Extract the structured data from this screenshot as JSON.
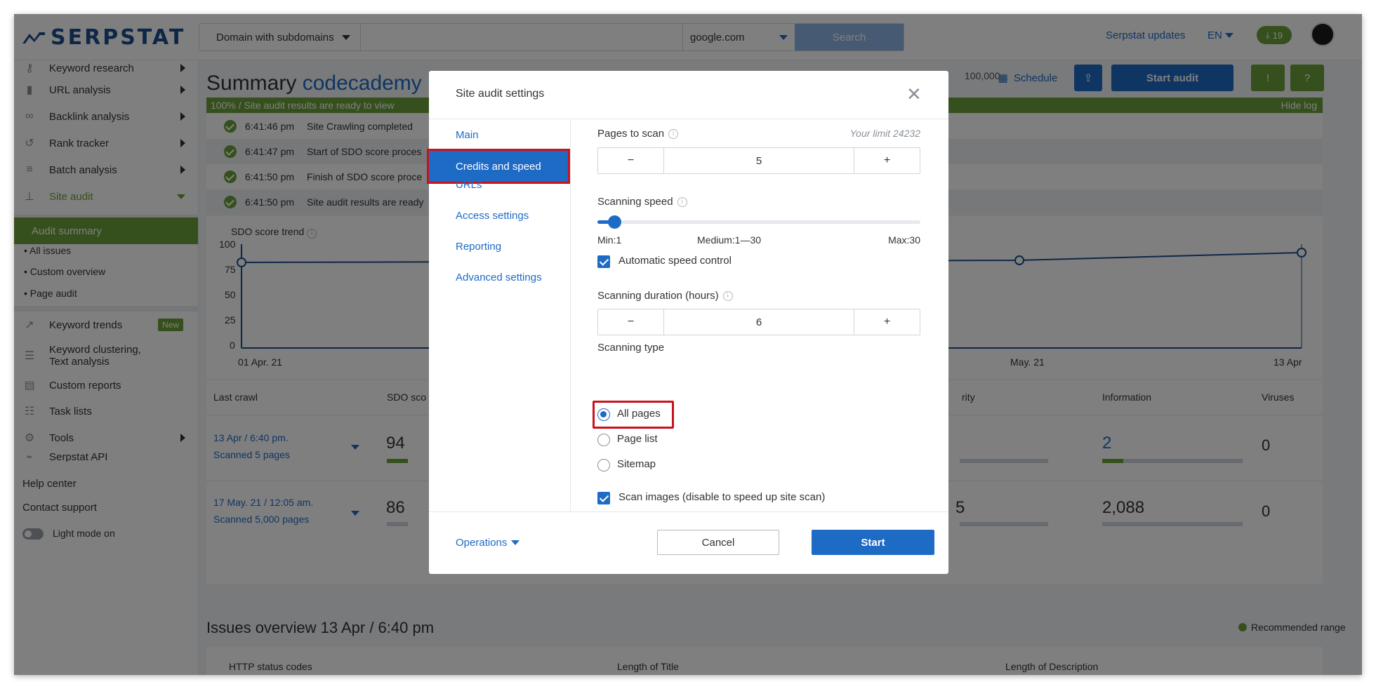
{
  "app": {
    "logo_text": "SERPSTAT",
    "brand_color": "#1d4f8f",
    "accent_color": "#6aa039",
    "link_color": "#1e6bc6"
  },
  "topbar": {
    "search_mode": "Domain with subdomains",
    "search_db": "google.com",
    "search_button": "Search",
    "updates_link": "Serpstat updates",
    "lang": "EN",
    "downloads_count": "19"
  },
  "sidebar": {
    "items": [
      {
        "label": "Keyword research",
        "icon": "key-icon"
      },
      {
        "label": "URL analysis",
        "icon": "bar-chart-icon"
      },
      {
        "label": "Backlink analysis",
        "icon": "link-icon"
      },
      {
        "label": "Rank tracker",
        "icon": "history-icon"
      },
      {
        "label": "Batch analysis",
        "icon": "database-icon"
      },
      {
        "label": "Site audit",
        "icon": "sitemap-icon"
      }
    ],
    "site_audit_sub": {
      "active": "Audit summary",
      "items": [
        "All issues",
        "Custom overview",
        "Page audit"
      ]
    },
    "tools": [
      {
        "label": "Keyword trends",
        "badge": "New",
        "icon": "trend-icon"
      },
      {
        "label": "Keyword clustering, Text analysis",
        "icon": "list-icon"
      },
      {
        "label": "Custom reports",
        "icon": "report-icon"
      },
      {
        "label": "Task lists",
        "icon": "checklist-icon"
      },
      {
        "label": "Tools",
        "icon": "gear-icon"
      },
      {
        "label": "Serpstat API",
        "icon": "api-icon"
      }
    ],
    "footer": {
      "help": "Help center",
      "support": "Contact support",
      "light_mode": "Light mode on"
    }
  },
  "main": {
    "title_prefix": "Summary",
    "title_domain": "codecademy",
    "credits_text": "100,000",
    "schedule_label": "Schedule",
    "start_audit_label": "Start audit",
    "progress_text": "100% / Site audit results are ready to view",
    "hide_log": "Hide log",
    "log": [
      {
        "time": "6:41:46 pm",
        "text": "Site Crawling completed"
      },
      {
        "time": "6:41:47 pm",
        "text": "Start of SDO score proces"
      },
      {
        "time": "6:41:50 pm",
        "text": "Finish of SDO score proce"
      },
      {
        "time": "6:41:50 pm",
        "text": "Site audit results are ready"
      }
    ],
    "trend": {
      "title": "SDO score trend",
      "y_ticks": [
        "100",
        "75",
        "50",
        "25",
        "0"
      ],
      "x_labels": [
        "01 Apr. 21",
        "May. 21",
        "13 Apr"
      ]
    },
    "table": {
      "headers": [
        "Last crawl",
        "SDO sco",
        "rity",
        "Information",
        "Viruses"
      ],
      "rows": [
        {
          "crawl": "13 Apr / 6:40 pm.",
          "pages": "Scanned 5 pages",
          "sdo": "94",
          "info": "2",
          "viruses": "0"
        },
        {
          "crawl": "17 May. 21 / 12:05 am.",
          "pages": "Scanned 5,000 pages",
          "sdo": "86",
          "priority": "5",
          "info": "2,088",
          "viruses": "0"
        }
      ]
    },
    "issues": {
      "title": "Issues overview 13 Apr / 6:40 pm",
      "recommended": "Recommended range",
      "cards": [
        "HTTP status codes",
        "Length of Title",
        "Length of Description"
      ]
    }
  },
  "modal": {
    "title": "Site audit settings",
    "nav": [
      "Main",
      "Credits and speed",
      "URLs",
      "Access settings",
      "Reporting",
      "Advanced settings"
    ],
    "active_nav": "Credits and speed",
    "pages_to_scan": {
      "label": "Pages to scan",
      "limit": "Your limit 24232",
      "value": "5",
      "minus": "−",
      "plus": "+"
    },
    "scanning_speed": {
      "label": "Scanning speed",
      "value": 1,
      "min": 1,
      "max": 30,
      "min_label": "Min:1",
      "medium_label": "Medium:1—30",
      "max_label": "Max:30"
    },
    "auto_speed": {
      "label": "Automatic speed control",
      "checked": true
    },
    "scanning_duration": {
      "label": "Scanning duration (hours)",
      "value": "6",
      "minus": "−",
      "plus": "+"
    },
    "scanning_type": {
      "label": "Scanning type",
      "options": [
        "All pages",
        "Page list",
        "Sitemap"
      ],
      "selected": "All pages"
    },
    "scan_images": {
      "label": "Scan images (disable to speed up site scan)",
      "checked": true
    },
    "operations": "Operations",
    "cancel": "Cancel",
    "start": "Start"
  }
}
